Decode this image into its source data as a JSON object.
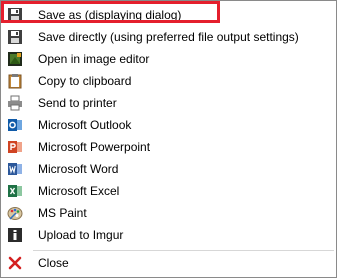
{
  "menu": {
    "items": [
      {
        "label": "Save as (displaying dialog)",
        "icon": "floppy-disk-icon"
      },
      {
        "label": "Save directly (using preferred file output settings)",
        "icon": "floppy-disk-save-icon"
      },
      {
        "label": "Open in image editor",
        "icon": "image-editor-icon"
      },
      {
        "label": "Copy to clipboard",
        "icon": "clipboard-icon"
      },
      {
        "label": "Send to printer",
        "icon": "printer-icon"
      },
      {
        "label": "Microsoft Outlook",
        "icon": "outlook-icon"
      },
      {
        "label": "Microsoft Powerpoint",
        "icon": "powerpoint-icon"
      },
      {
        "label": "Microsoft Word",
        "icon": "word-icon"
      },
      {
        "label": "Microsoft Excel",
        "icon": "excel-icon"
      },
      {
        "label": "MS Paint",
        "icon": "paint-palette-icon"
      },
      {
        "label": "Upload to Imgur",
        "icon": "imgur-icon"
      },
      {
        "label": "Close",
        "icon": "close-icon"
      }
    ],
    "highlight_color": "#e41f2d"
  }
}
